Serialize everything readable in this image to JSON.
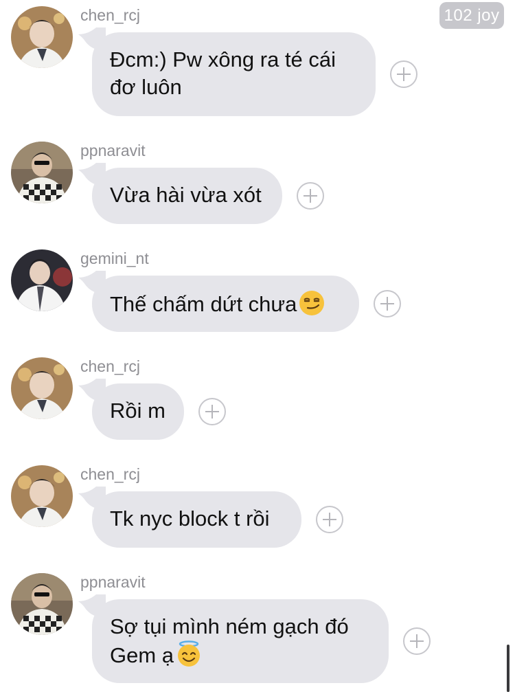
{
  "header": {
    "reaction_badge": "102 joy"
  },
  "messages": [
    {
      "username": "chen_rcj",
      "line1": "Đcm:) Pw xông ra té cái",
      "line2": "đơ luôn",
      "emoji": "",
      "avatar": "chen_rcj-avatar"
    },
    {
      "username": "ppnaravit",
      "line1": "Vừa hài vừa xót",
      "line2": "",
      "emoji": "",
      "avatar": "ppnaravit-avatar"
    },
    {
      "username": "gemini_nt",
      "line1": "Thế chấm dứt chưa",
      "line2": "",
      "emoji": "smirking-face",
      "avatar": "gemini_nt-avatar"
    },
    {
      "username": "chen_rcj",
      "line1": "Rồi m",
      "line2": "",
      "emoji": "",
      "avatar": "chen_rcj-avatar"
    },
    {
      "username": "chen_rcj",
      "line1": "Tk nyc block t rồi",
      "line2": "",
      "emoji": "",
      "avatar": "chen_rcj-avatar"
    },
    {
      "username": "ppnaravit",
      "line1": "Sợ tụi mình ném gạch đó",
      "line2": "Gem ạ",
      "emoji": "smiling-face-with-halo",
      "avatar": "ppnaravit-avatar"
    }
  ],
  "icons": {
    "add_reaction": "plus-circle-icon"
  },
  "colors": {
    "bubble": "#e5e5ea",
    "username": "#8e8e93",
    "badge": "#c7c7cc"
  }
}
